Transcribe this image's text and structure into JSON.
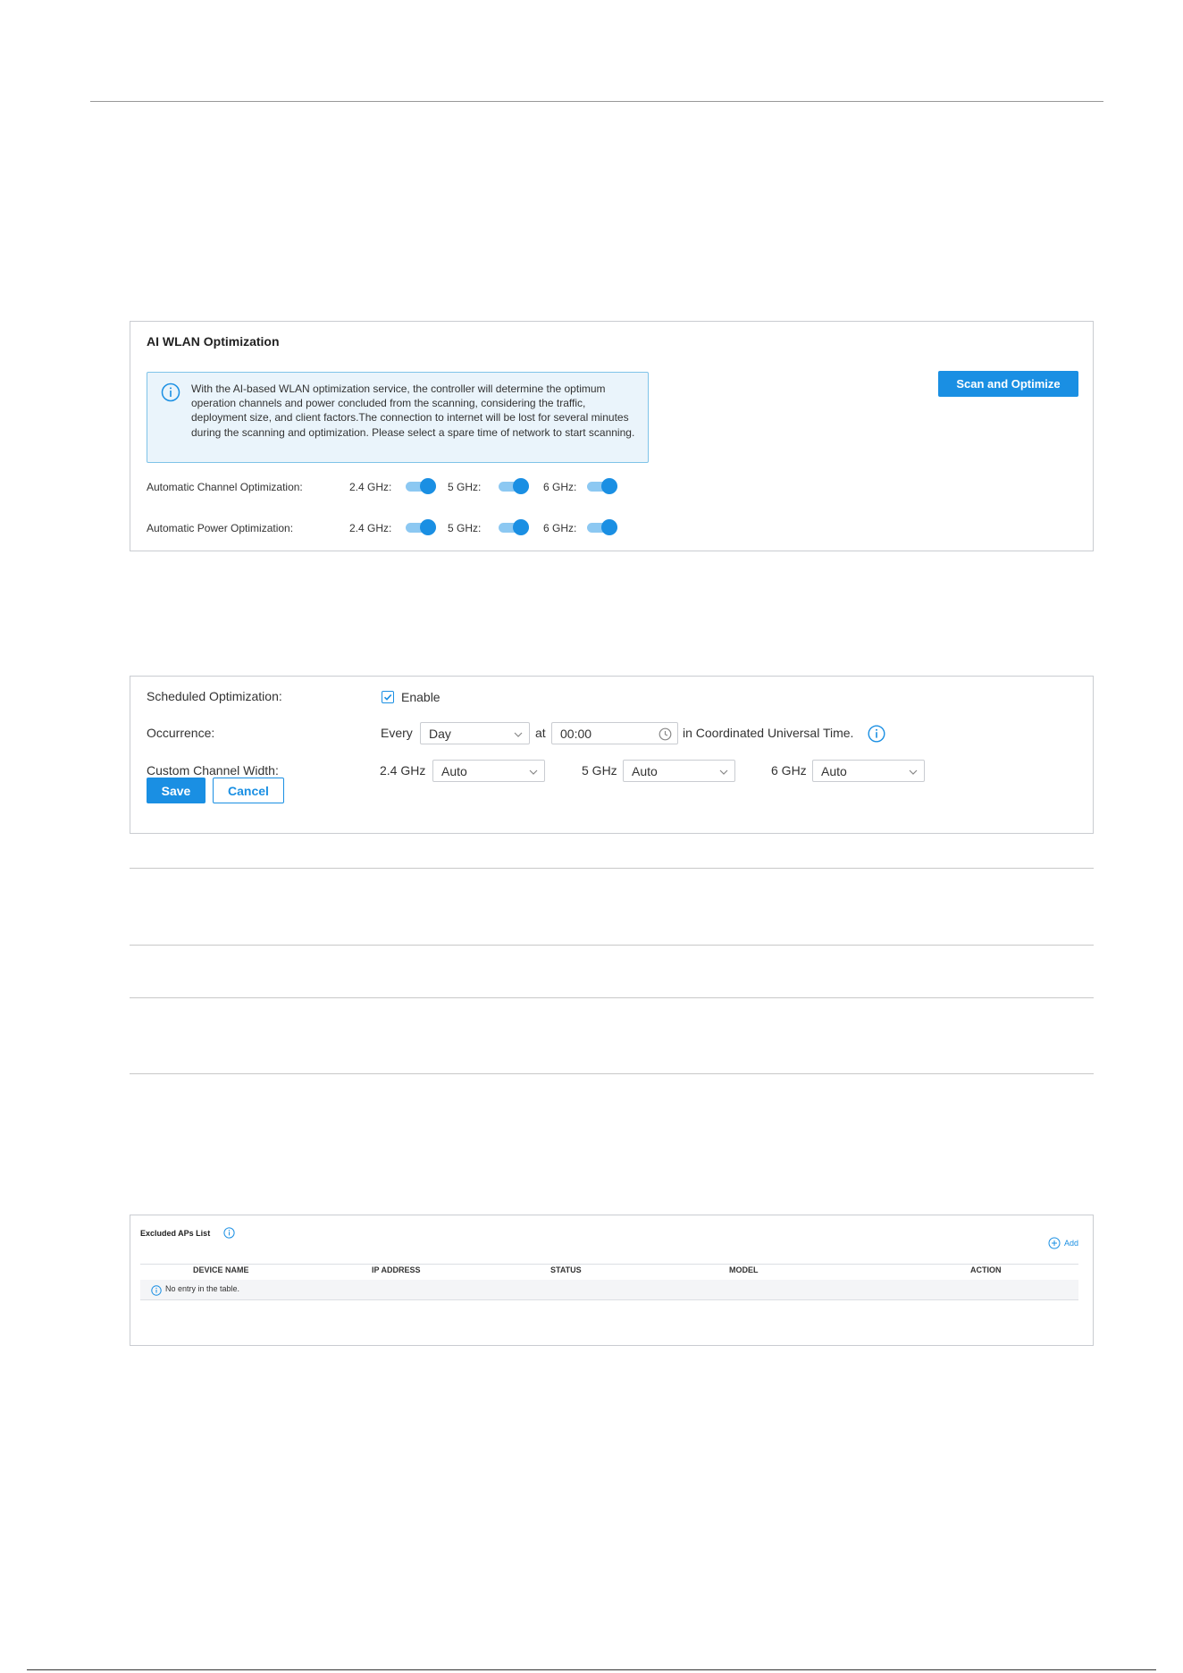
{
  "ai_wlan": {
    "title": "AI WLAN Optimization",
    "notice_text": "With the AI-based WLAN optimization service, the controller will determine the optimum operation channels and power concluded from the scanning, considering the traffic, deployment size, and client factors.The connection to internet will be lost for several minutes during the scanning and optimization. Please select a spare time of network to start scanning.",
    "scan_button": "Scan and Optimize",
    "channel_label": "Automatic Channel Optimization:",
    "power_label": "Automatic Power Optimization:",
    "band_24": "2.4 GHz:",
    "band_5": "5 GHz:",
    "band_6": "6 GHz:",
    "accent_color": "#1a8fe3"
  },
  "scheduled": {
    "label": "Scheduled Optimization:",
    "enable_label": "Enable",
    "enable_checked": true,
    "occurrence_label": "Occurrence:",
    "every_label": "Every",
    "occurrence_value": "Day",
    "at_label": "at",
    "time_value": "00:00",
    "timezone_text": "in Coordinated Universal Time.",
    "channel_width_label": "Custom Channel Width:",
    "band_24": "2.4 GHz",
    "band_5": "5 GHz",
    "band_6": "6 GHz",
    "width_24": "Auto",
    "width_5": "Auto",
    "width_6": "Auto",
    "save_button": "Save",
    "cancel_button": "Cancel"
  },
  "excluded": {
    "title": "Excluded APs List",
    "add_label": "Add",
    "columns": [
      "DEVICE NAME",
      "IP ADDRESS",
      "STATUS",
      "MODEL",
      "ACTION"
    ],
    "empty_text": "No entry in the table."
  }
}
